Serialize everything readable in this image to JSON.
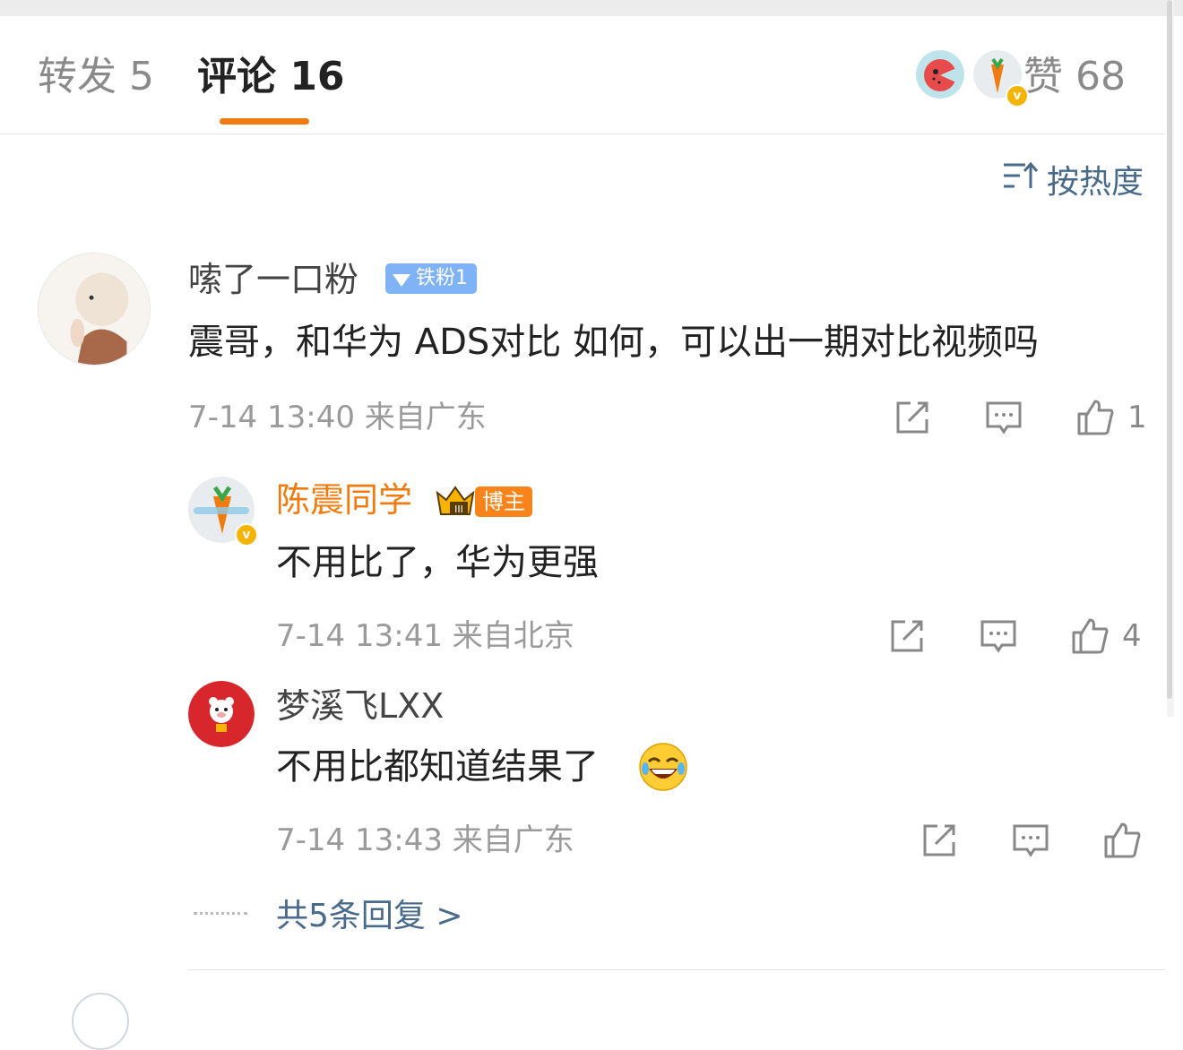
{
  "tabs": {
    "repost": "转发 5",
    "comments": "评论 16",
    "likes": "赞 68"
  },
  "sort": {
    "label": "按热度"
  },
  "comment": {
    "user": "嗦了一口粉",
    "fan_badge": "铁粉1",
    "text": "震哥，和华为 ADS对比 如何，可以出一期对比视频吗",
    "time": "7-14 13:40",
    "location": "来自广东",
    "meta": "7-14 13:40  来自广东",
    "likes": "1"
  },
  "replies": [
    {
      "user": "陈震同学",
      "badge": "博主",
      "crown_level": "III",
      "text": "不用比了，华为更强",
      "meta": "7-14 13:41  来自北京",
      "likes": "4"
    },
    {
      "user": "梦溪飞LXX",
      "text": "不用比都知道结果了",
      "meta": "7-14 13:43  来自广东",
      "likes": ""
    }
  ],
  "more_replies": "共5条回复 >",
  "icons": {
    "forward": "share-icon",
    "comment": "comment-icon",
    "like": "thumbs-up-icon",
    "sort": "sort-icon",
    "verified": "verified-badge-icon"
  },
  "colors": {
    "accent_orange": "#f07c11",
    "link_blue": "#4a6a8a",
    "fan_badge": "#7fb3f5",
    "verified": "#f6b400"
  }
}
